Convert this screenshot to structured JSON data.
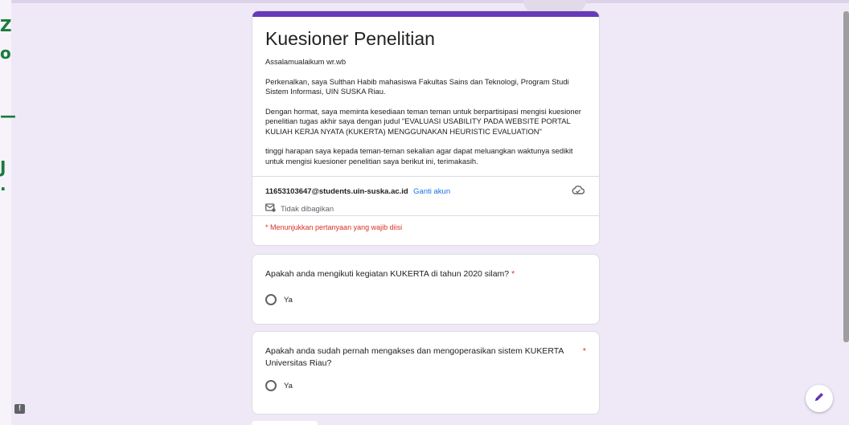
{
  "form": {
    "title": "Kuesioner Penelitian",
    "description": [
      "Assalamualaikum wr.wb",
      "Perkenalkan, saya Sulthan Habib mahasiswa Fakultas Sains dan Teknologi, Program Studi Sistem Informasi, UIN SUSKA Riau.",
      "Dengan hormat, saya meminta kesediaan teman teman untuk berpartisipasi mengisi kuesioner penelitian tugas akhir saya dengan judul \"EVALUASI USABILITY PADA WEBSITE PORTAL KULIAH KERJA NYATA (KUKERTA) MENGGUNAKAN HEURISTIC EVALUATION\"",
      "tinggi harapan saya kepada teman-teman sekalian agar dapat meluangkan waktunya sedikit untuk mengisi kuesioner penelitian saya berikut ini, terimakasih."
    ],
    "accent_color": "#673ab7"
  },
  "account": {
    "email": "11653103647@students.uin-suska.ac.id",
    "switch_label": "Ganti akun",
    "not_shared": "Tidak dibagikan"
  },
  "required_note": "* Menunjukkan pertanyaan yang wajib diisi",
  "questions": [
    {
      "text": "Apakah anda mengikuti kegiatan KUKERTA di tahun 2020 silam?",
      "required_mark": "*",
      "option": "Ya"
    },
    {
      "text": "Apakah anda sudah pernah mengakses dan mengoperasikan sistem KUKERTA Universitas Riau?",
      "required_mark": "*",
      "option": "Ya"
    }
  ],
  "icons": {
    "cloud": "cloud-saved-icon",
    "shared": "not-shared-icon",
    "edit": "pencil-icon",
    "report": "report-icon"
  },
  "left_strip_glyphs": [
    "Z",
    "o",
    "—",
    "J",
    "."
  ]
}
